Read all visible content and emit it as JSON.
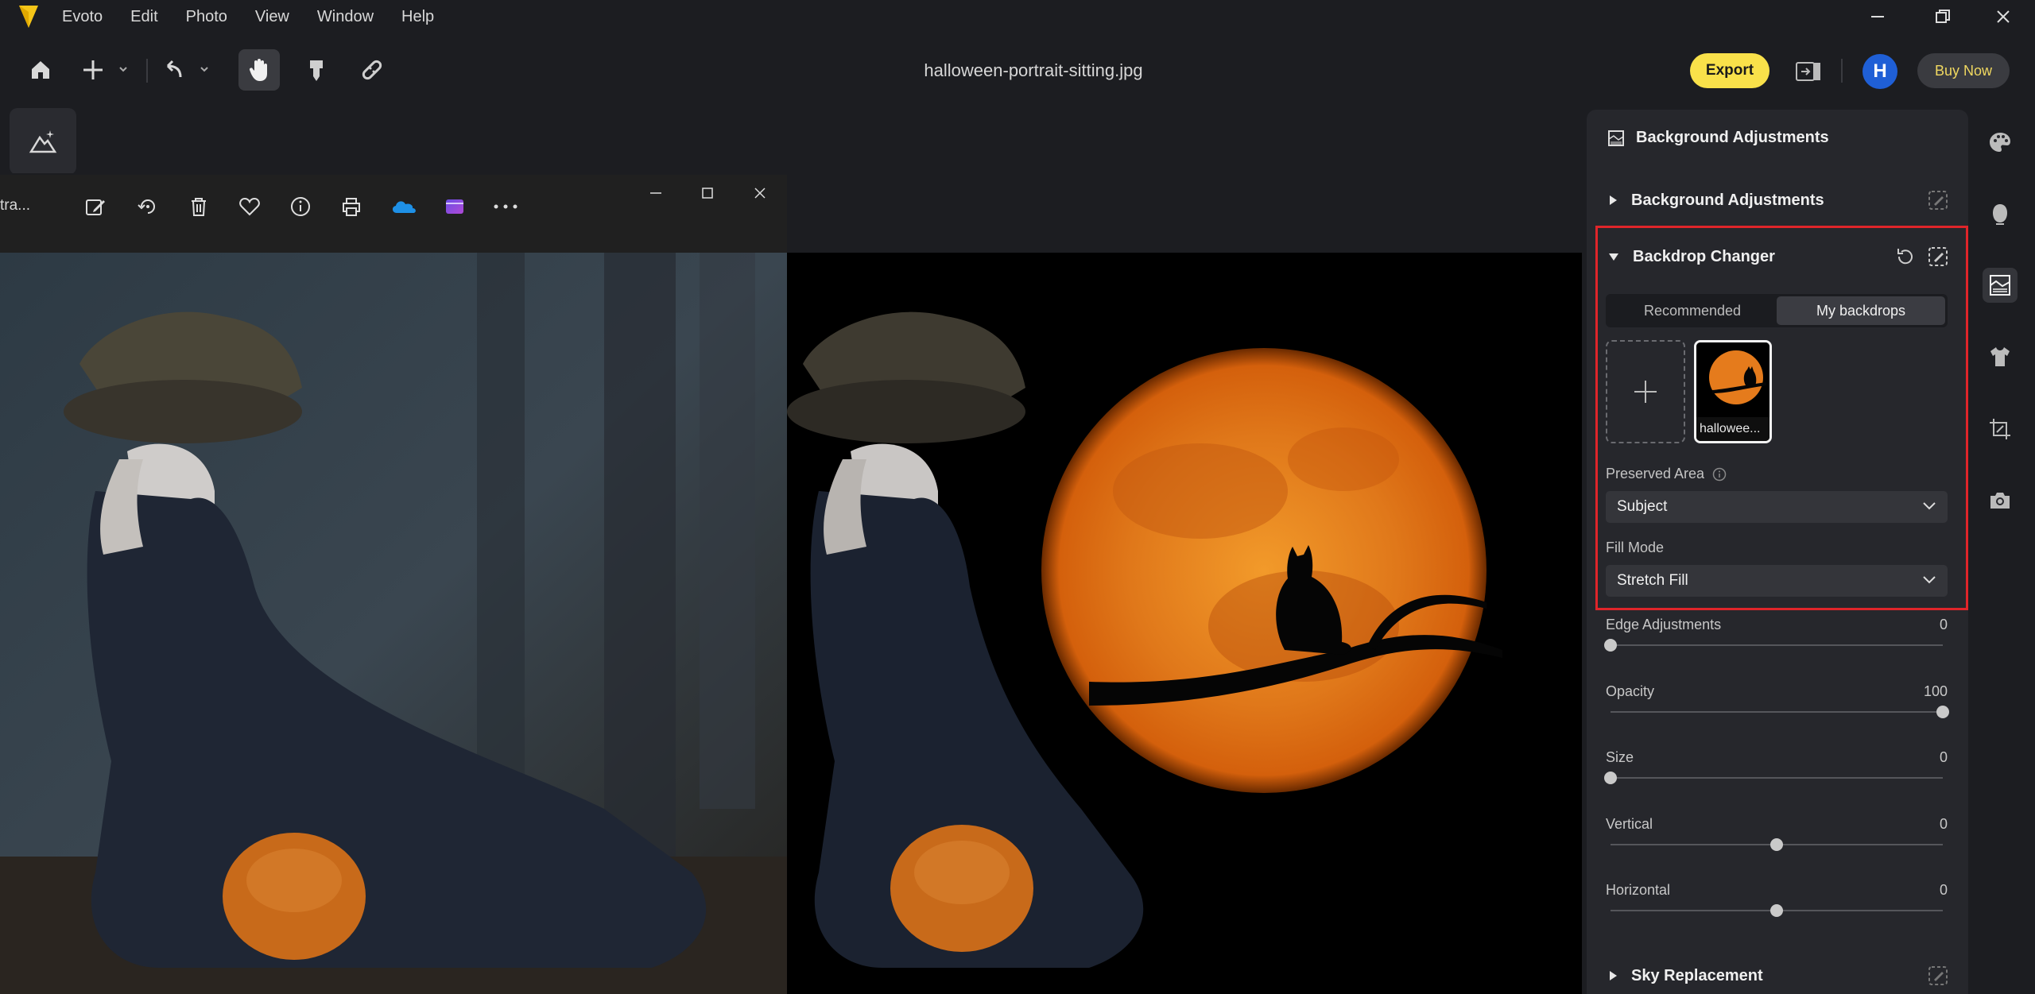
{
  "app": {
    "name": "Evoto",
    "menu": [
      "Evoto",
      "Edit",
      "Photo",
      "View",
      "Window",
      "Help"
    ],
    "brand_color": "#f5c518"
  },
  "toolbar": {
    "document_title": "halloween-portrait-sitting.jpg",
    "export_label": "Export",
    "avatar_initial": "H",
    "buy_label": "Buy Now",
    "icons": [
      "home-icon",
      "add-icon",
      "undo-icon",
      "hand-icon",
      "retouch-brush-icon",
      "bandage-icon",
      "compare-icon"
    ]
  },
  "photos_viewer": {
    "title": "tra...",
    "icons": [
      "edit-image-icon",
      "rotate-icon",
      "delete-icon",
      "favorite-icon",
      "info-icon",
      "print-icon",
      "onedrive-icon",
      "clipchamp-icon",
      "more-icon"
    ]
  },
  "panel": {
    "header": "Background Adjustments",
    "sections": {
      "background_adjustments": "Background Adjustments",
      "backdrop_changer": "Backdrop Changer",
      "sky_replacement": "Sky Replacement"
    },
    "tabs": [
      "Recommended",
      "My backdrops"
    ],
    "active_tab": "My backdrops",
    "backdrop_thumb_label": "hallowee...",
    "preserved_area": {
      "label": "Preserved Area",
      "value": "Subject"
    },
    "fill_mode": {
      "label": "Fill Mode",
      "value": "Stretch Fill"
    },
    "sliders": [
      {
        "label": "Edge Adjustments",
        "value": "0",
        "fraction": 0.0
      },
      {
        "label": "Opacity",
        "value": "100",
        "fraction": 1.0
      },
      {
        "label": "Size",
        "value": "0",
        "fraction": 0.0
      },
      {
        "label": "Vertical",
        "value": "0",
        "fraction": 0.5
      },
      {
        "label": "Horizontal",
        "value": "0",
        "fraction": 0.5
      }
    ],
    "highlight_color": "#e0252a"
  },
  "right_strip": {
    "icons": [
      "palette-icon",
      "face-icon",
      "background-icon",
      "clothing-icon",
      "crop-icon",
      "camera-icon"
    ],
    "active": "background-icon"
  }
}
